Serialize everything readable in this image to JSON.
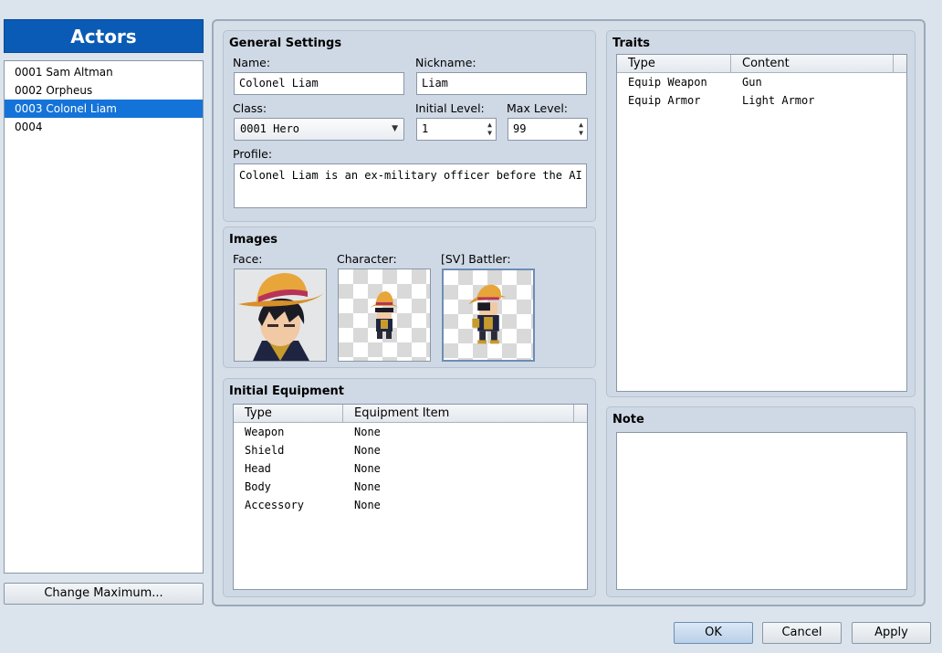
{
  "actors": {
    "title": "Actors",
    "items": [
      {
        "label": "0001 Sam Altman"
      },
      {
        "label": "0002 Orpheus"
      },
      {
        "label": "0003 Colonel Liam"
      },
      {
        "label": "0004"
      }
    ],
    "selected_index": 2,
    "change_max_label": "Change Maximum..."
  },
  "general": {
    "title": "General Settings",
    "name_label": "Name:",
    "name_value": "Colonel Liam",
    "nickname_label": "Nickname:",
    "nickname_value": "Liam",
    "class_label": "Class:",
    "class_value": "0001 Hero",
    "initial_level_label": "Initial Level:",
    "initial_level_value": "1",
    "max_level_label": "Max Level:",
    "max_level_value": "99",
    "profile_label": "Profile:",
    "profile_value": "Colonel Liam is an ex-military officer before the AI tak"
  },
  "images": {
    "title": "Images",
    "face_label": "Face:",
    "character_label": "Character:",
    "battler_label": "[SV] Battler:"
  },
  "equipment": {
    "title": "Initial Equipment",
    "col_type": "Type",
    "col_item": "Equipment Item",
    "rows": [
      {
        "type": "Weapon",
        "item": "None"
      },
      {
        "type": "Shield",
        "item": "None"
      },
      {
        "type": "Head",
        "item": "None"
      },
      {
        "type": "Body",
        "item": "None"
      },
      {
        "type": "Accessory",
        "item": "None"
      }
    ]
  },
  "traits": {
    "title": "Traits",
    "col_type": "Type",
    "col_content": "Content",
    "rows": [
      {
        "type": "Equip Weapon",
        "content": "Gun"
      },
      {
        "type": "Equip Armor",
        "content": "Light Armor"
      }
    ]
  },
  "note": {
    "title": "Note"
  },
  "buttons": {
    "ok": "OK",
    "cancel": "Cancel",
    "apply": "Apply"
  },
  "colors": {
    "accent": "#0a5bb5",
    "selection": "#1473d9",
    "panel": "#cfd9e5"
  }
}
